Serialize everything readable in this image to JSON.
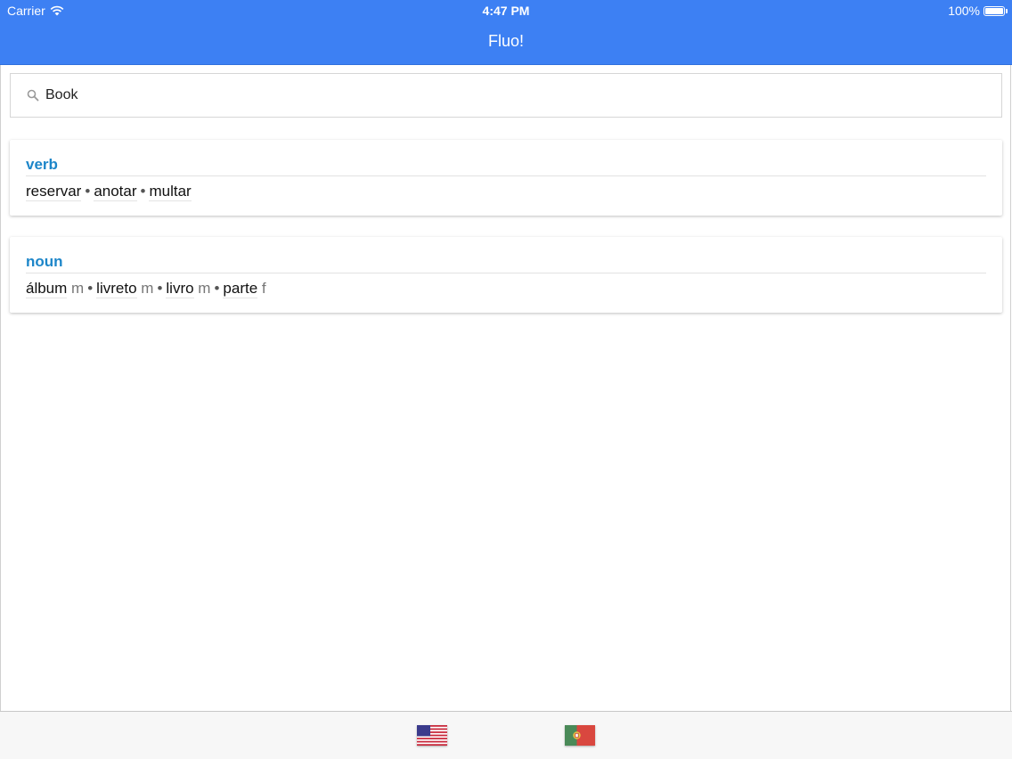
{
  "status_bar": {
    "carrier": "Carrier",
    "time": "4:47 PM",
    "battery": "100%"
  },
  "nav": {
    "title": "Fluo!"
  },
  "search": {
    "value": "Book"
  },
  "entries": [
    {
      "pos": "verb",
      "words": [
        {
          "text": "reservar",
          "gender": ""
        },
        {
          "text": "anotar",
          "gender": ""
        },
        {
          "text": "multar",
          "gender": ""
        }
      ]
    },
    {
      "pos": "noun",
      "words": [
        {
          "text": "álbum",
          "gender": "m"
        },
        {
          "text": "livreto",
          "gender": "m"
        },
        {
          "text": "livro",
          "gender": "m"
        },
        {
          "text": "parte",
          "gender": "f"
        }
      ]
    }
  ],
  "tabs": [
    {
      "icon": "us-flag-icon"
    },
    {
      "icon": "portugal-flag-icon"
    }
  ],
  "colors": {
    "accent": "#3d80f3",
    "pos_label": "#1d86c9"
  }
}
